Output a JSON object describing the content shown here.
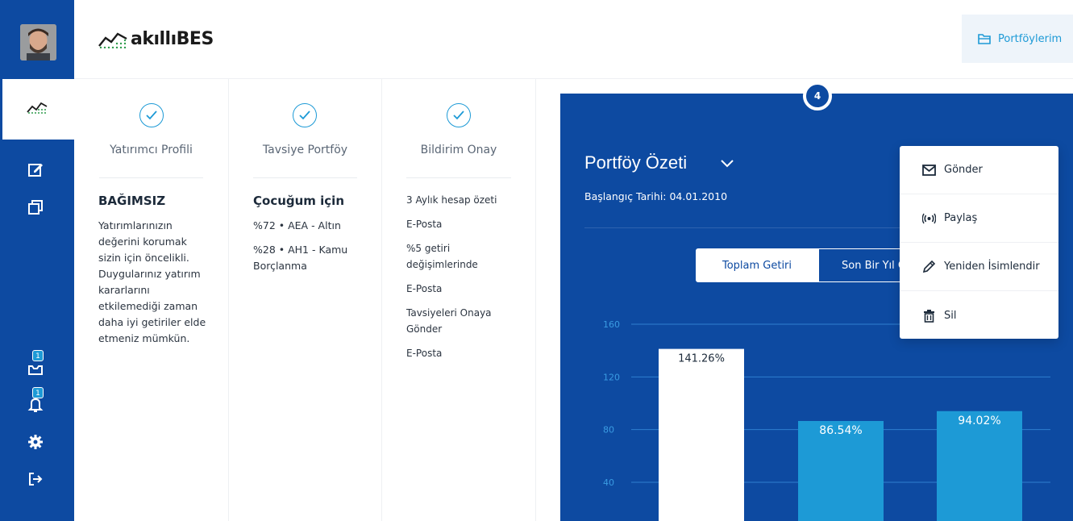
{
  "brand": {
    "name_prefix": "akıllı",
    "name_suffix": "BES"
  },
  "header": {
    "portfolios_label": "Portföylerim"
  },
  "sidebar": {
    "avatar": "user-avatar",
    "items": [
      {
        "icon": "chart-icon",
        "active": true
      },
      {
        "icon": "edit-icon"
      },
      {
        "icon": "copy-icon"
      },
      {
        "icon": "inbox-icon",
        "badge": "1"
      },
      {
        "icon": "bell-icon",
        "badge": "1"
      },
      {
        "icon": "gear-icon"
      },
      {
        "icon": "logout-icon"
      }
    ]
  },
  "steps": [
    {
      "title": "Yatırımcı Profili",
      "heading": "BAĞIMSIZ",
      "lines": [
        "Yatırımlarınızın değerini korumak sizin için öncelikli. Duygularınız yatırım kararlarını etkilemediği zaman daha iyi getiriler elde etmeniz mümkün."
      ]
    },
    {
      "title": "Tavsiye Portföy",
      "heading": "Çocuğum için",
      "lines": [
        "%72 • AEA - Altın",
        "%28 • AH1 - Kamu Borçlanma"
      ]
    },
    {
      "title": "Bildirim Onay",
      "heading": "",
      "lines": [
        "3 Aylık hesap özeti",
        "E-Posta",
        "%5 getiri değişimlerinde",
        "E-Posta",
        "Tavsiyeleri Onaya Gönder",
        "E-Posta"
      ]
    }
  ],
  "summary": {
    "step_number": "4",
    "title": "Portföy Özeti",
    "start_date": "Başlangıç Tarihi: 04.01.2010",
    "tabs": [
      "Toplam Getiri",
      "Son Bir Yıl Ge"
    ]
  },
  "menu": {
    "items": [
      {
        "label": "Gönder",
        "icon": "mail-icon"
      },
      {
        "label": "Paylaş",
        "icon": "broadcast-icon"
      },
      {
        "label": "Yeniden İsimlendir",
        "icon": "pencil-icon"
      },
      {
        "label": "Sil",
        "icon": "trash-icon"
      }
    ]
  },
  "colors": {
    "primary": "#0d4aa1",
    "accent": "#1d9ad6",
    "bar_highlight": "#ffffff"
  },
  "chart_data": {
    "type": "bar",
    "yticks": [
      40,
      80,
      120,
      160
    ],
    "ylim": [
      0,
      160
    ],
    "values": [
      141.26,
      86.54,
      94.02
    ],
    "labels": [
      "141.26%",
      "86.54%",
      "94.02%"
    ],
    "grid": true
  }
}
